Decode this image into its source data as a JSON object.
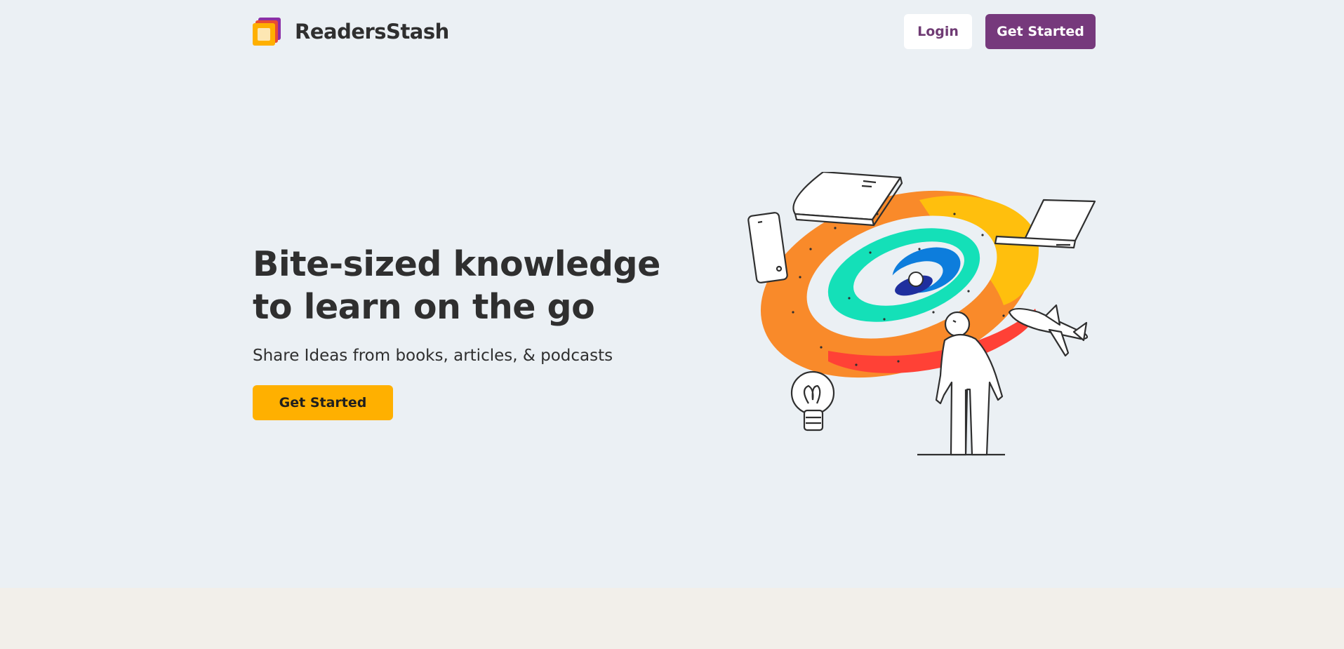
{
  "brand": {
    "name": "ReadersStash",
    "logo_icon": "stacked-squares-logo-icon",
    "colors": {
      "logo_back": "#8b2fa6",
      "logo_mid": "#e94d33",
      "logo_front": "#ffb000",
      "logo_inner": "#fde7b3"
    }
  },
  "nav": {
    "login_label": "Login",
    "get_started_label": "Get Started"
  },
  "hero": {
    "title": "Bite-sized knowledge to learn on the go",
    "subtitle": "Share Ideas from books, articles, & podcasts",
    "cta_label": "Get Started"
  },
  "illustration": {
    "icons": [
      "book-icon",
      "laptop-icon",
      "phone-icon",
      "airplane-icon",
      "lightbulb-icon",
      "person-icon",
      "swirl-graphic"
    ],
    "colors": {
      "orange": "#f98a2a",
      "yellow": "#ffbf0d",
      "red": "#ff4136",
      "teal": "#14e0b8",
      "blue": "#0d7ddc",
      "navy": "#1f2f9e",
      "accent_purple": "#76397c",
      "accent_yellow": "#ffb000"
    }
  }
}
